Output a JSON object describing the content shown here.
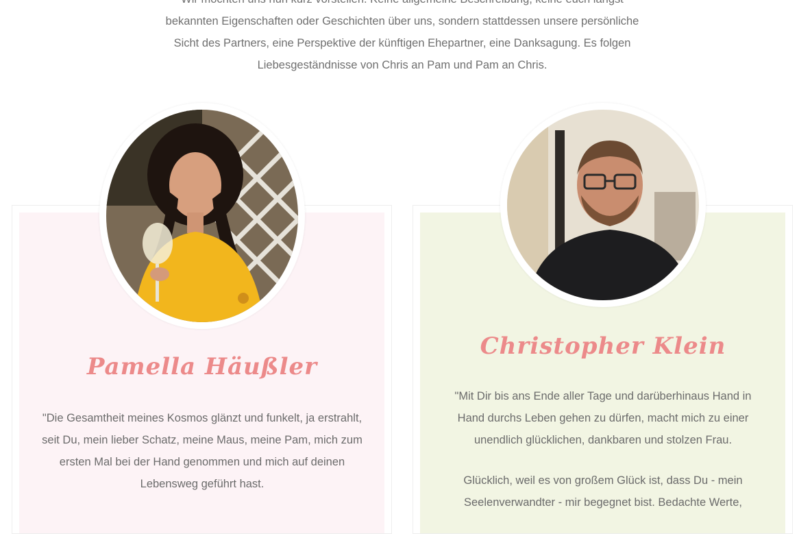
{
  "intro": {
    "text": "Wir möchten uns nun kurz vorstellen. Keine allgemeine Beschreibung, keine euch längst bekannten Eigenschaften oder Geschichten über uns, sondern stattdessen unsere persönliche Sicht des Partners, eine Perspektive der künftigen Ehepartner, eine Danksagung. Es folgen Liebesgeständnisse von Chris an Pam und Pam an Chris."
  },
  "profiles": [
    {
      "name": "Pamella Häußler",
      "quote": "\"Die Gesamtheit meines Kosmos glänzt und funkelt, ja erstrahlt, seit Du, mein lieber Schatz, meine Maus, meine Pam, mich zum ersten Mal bei der Hand genommen und mich auf deinen Lebensweg geführt hast.",
      "card_color": "#fdf3f6"
    },
    {
      "name": "Christopher Klein",
      "quote_1": "\"Mit Dir bis ans Ende aller Tage und darüberhinaus Hand in Hand durchs Leben gehen zu dürfen, macht mich zu einer unendlich glücklichen, dankbaren und stolzen Frau.",
      "quote_2": "Glücklich, weil es von großem Glück ist, dass Du - mein Seelenverwandter - mir begegnet bist. Bedachte Werte,",
      "card_color": "#f2f5e3"
    }
  ],
  "colors": {
    "name_accent": "#ec8a8a",
    "text": "#6b6b6b"
  }
}
